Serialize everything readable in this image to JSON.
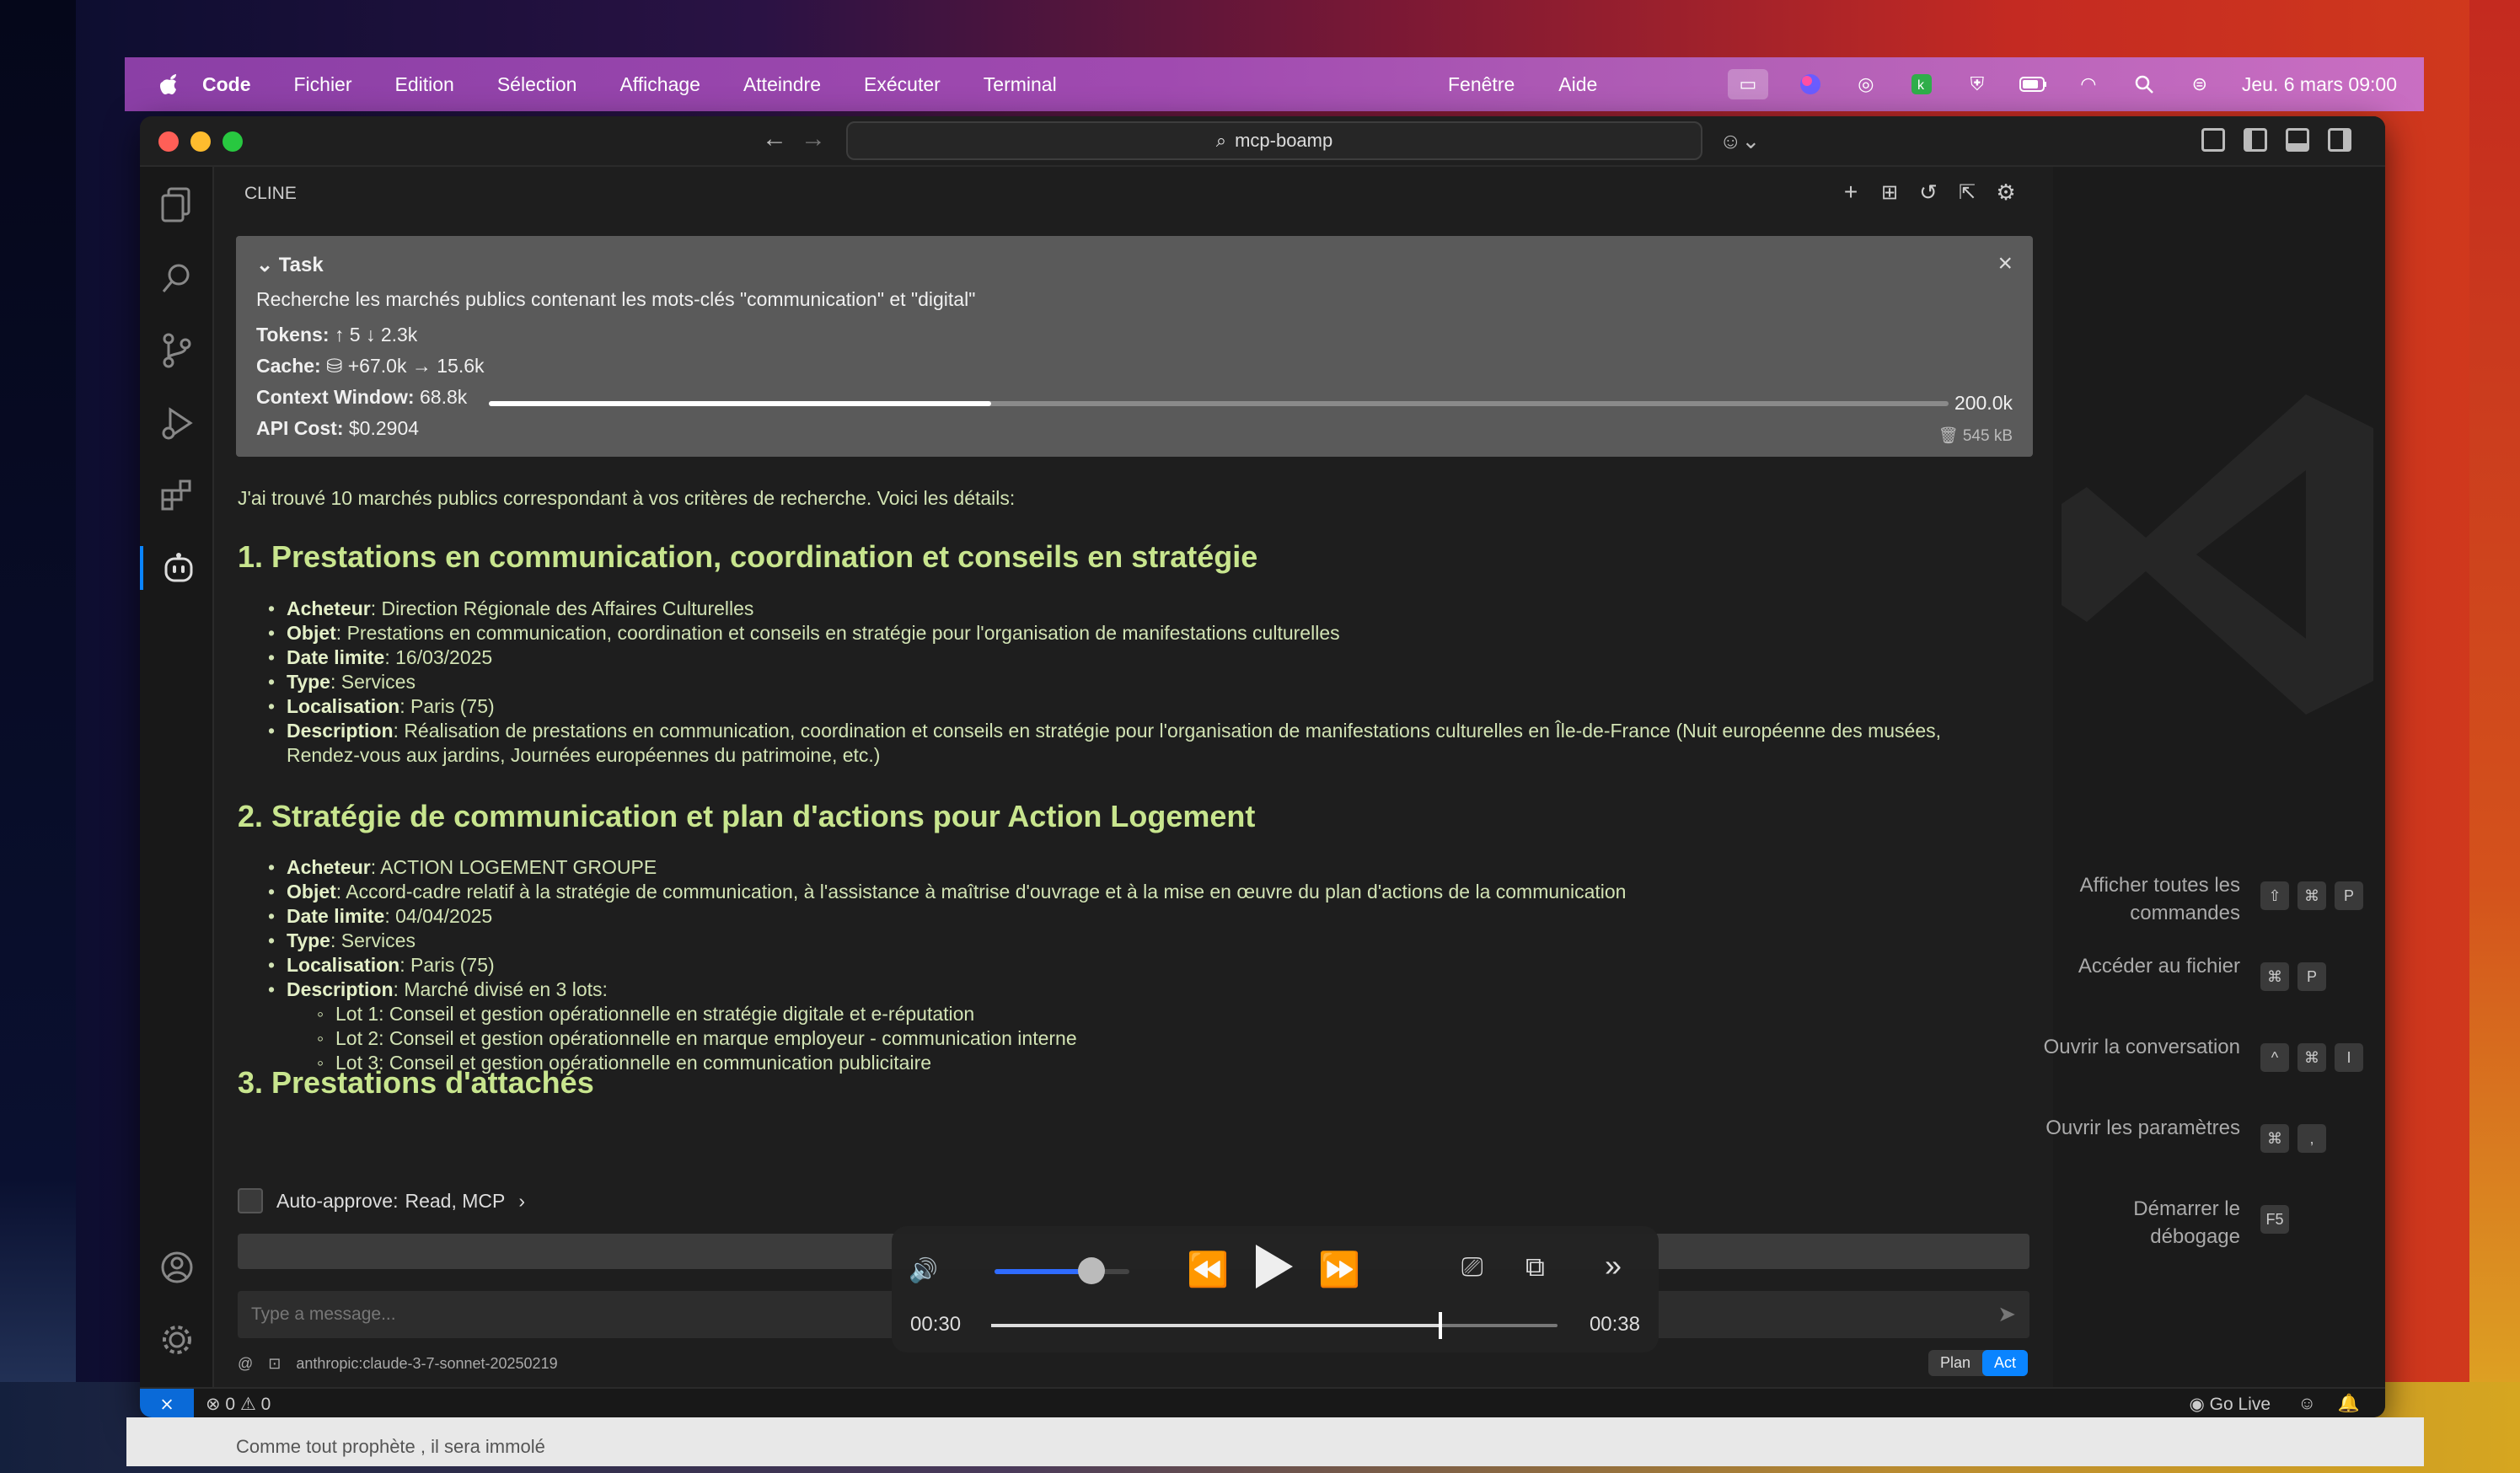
{
  "menubar": {
    "app": "Code",
    "items": [
      "Fichier",
      "Edition",
      "Sélection",
      "Affichage",
      "Atteindre",
      "Exécuter",
      "Terminal"
    ],
    "window_items": [
      "Fenêtre",
      "Aide"
    ],
    "clock": "Jeu. 6 mars  09:00"
  },
  "window": {
    "search": "mcp-boamp"
  },
  "panel": {
    "title": "CLINE"
  },
  "task": {
    "header": "Task",
    "description": "Recherche les marchés publics contenant les mots-clés \"communication\" et \"digital\"",
    "tokens_label": "Tokens:",
    "tokens_value": "↑ 5  ↓ 2.3k",
    "cache_label": "Cache:",
    "cache_value": "⛁ +67.0k → 15.6k",
    "context_label": "Context Window:",
    "context_used": "68.8k",
    "context_max": "200.0k",
    "context_fraction": 0.344,
    "cost_label": "API Cost:",
    "cost_value": "$0.2904",
    "size": "545 kB"
  },
  "content": {
    "intro": "J'ai trouvé 10 marchés publics correspondant à vos critères de recherche. Voici les détails:",
    "s1": {
      "title": "1. Prestations en communication, coordination et conseils en stratégie",
      "acheteur": "Direction Régionale des Affaires Culturelles",
      "objet": "Prestations en communication, coordination et conseils en stratégie pour l'organisation de manifestations culturelles",
      "date": "16/03/2025",
      "type": "Services",
      "loc": "Paris (75)",
      "desc": "Réalisation de prestations en communication, coordination et conseils en stratégie pour l'organisation de manifestations culturelles en Île-de-France (Nuit européenne des musées, Rendez-vous aux jardins, Journées européennes du patrimoine, etc.)"
    },
    "s2": {
      "title": "2. Stratégie de communication et plan d'actions pour Action Logement",
      "acheteur": "ACTION LOGEMENT GROUPE",
      "objet": "Accord-cadre relatif à la stratégie de communication, à l'assistance à maîtrise d'ouvrage et à la mise en œuvre du plan d'actions de la communication",
      "date": "04/04/2025",
      "type": "Services",
      "loc": "Paris (75)",
      "desc": "Marché divisé en 3 lots:",
      "lots": [
        "Lot 1: Conseil et gestion opérationnelle en stratégie digitale et e-réputation",
        "Lot 2: Conseil et gestion opérationnelle en marque employeur - communication interne",
        "Lot 3: Conseil et gestion opérationnelle en communication publicitaire"
      ]
    },
    "s3": {
      "title": "3. Prestations d'attachés"
    },
    "labels": {
      "acheteur": "Acheteur",
      "objet": "Objet",
      "date": "Date limite",
      "type": "Type",
      "loc": "Localisation",
      "desc": "Description"
    }
  },
  "autoapprove": {
    "label": "Auto-approve:",
    "value": "Read, MCP"
  },
  "input": {
    "placeholder": "Type a message...",
    "model": "anthropic:claude-3-7-sonnet-20250219",
    "plan": "Plan",
    "act": "Act"
  },
  "shortcuts": [
    {
      "label": "Afficher toutes les commandes",
      "keys": [
        "⇧",
        "⌘",
        "P"
      ]
    },
    {
      "label": "Accéder au fichier",
      "keys": [
        "⌘",
        "P"
      ]
    },
    {
      "label": "Ouvrir la conversation",
      "keys": [
        "^",
        "⌘",
        "I"
      ]
    },
    {
      "label": "Ouvrir les paramètres",
      "keys": [
        "⌘",
        ","
      ]
    },
    {
      "label": "Démarrer le débogage",
      "keys": [
        "F5"
      ]
    }
  ],
  "status": {
    "errors": "⊗ 0 ⚠ 0",
    "golive": "Go Live"
  },
  "media": {
    "elapsed": "00:30",
    "total": "00:38",
    "progress": 0.79,
    "volume": 0.72
  },
  "behind": {
    "text": "Comme tout prophète , il sera immolé"
  }
}
